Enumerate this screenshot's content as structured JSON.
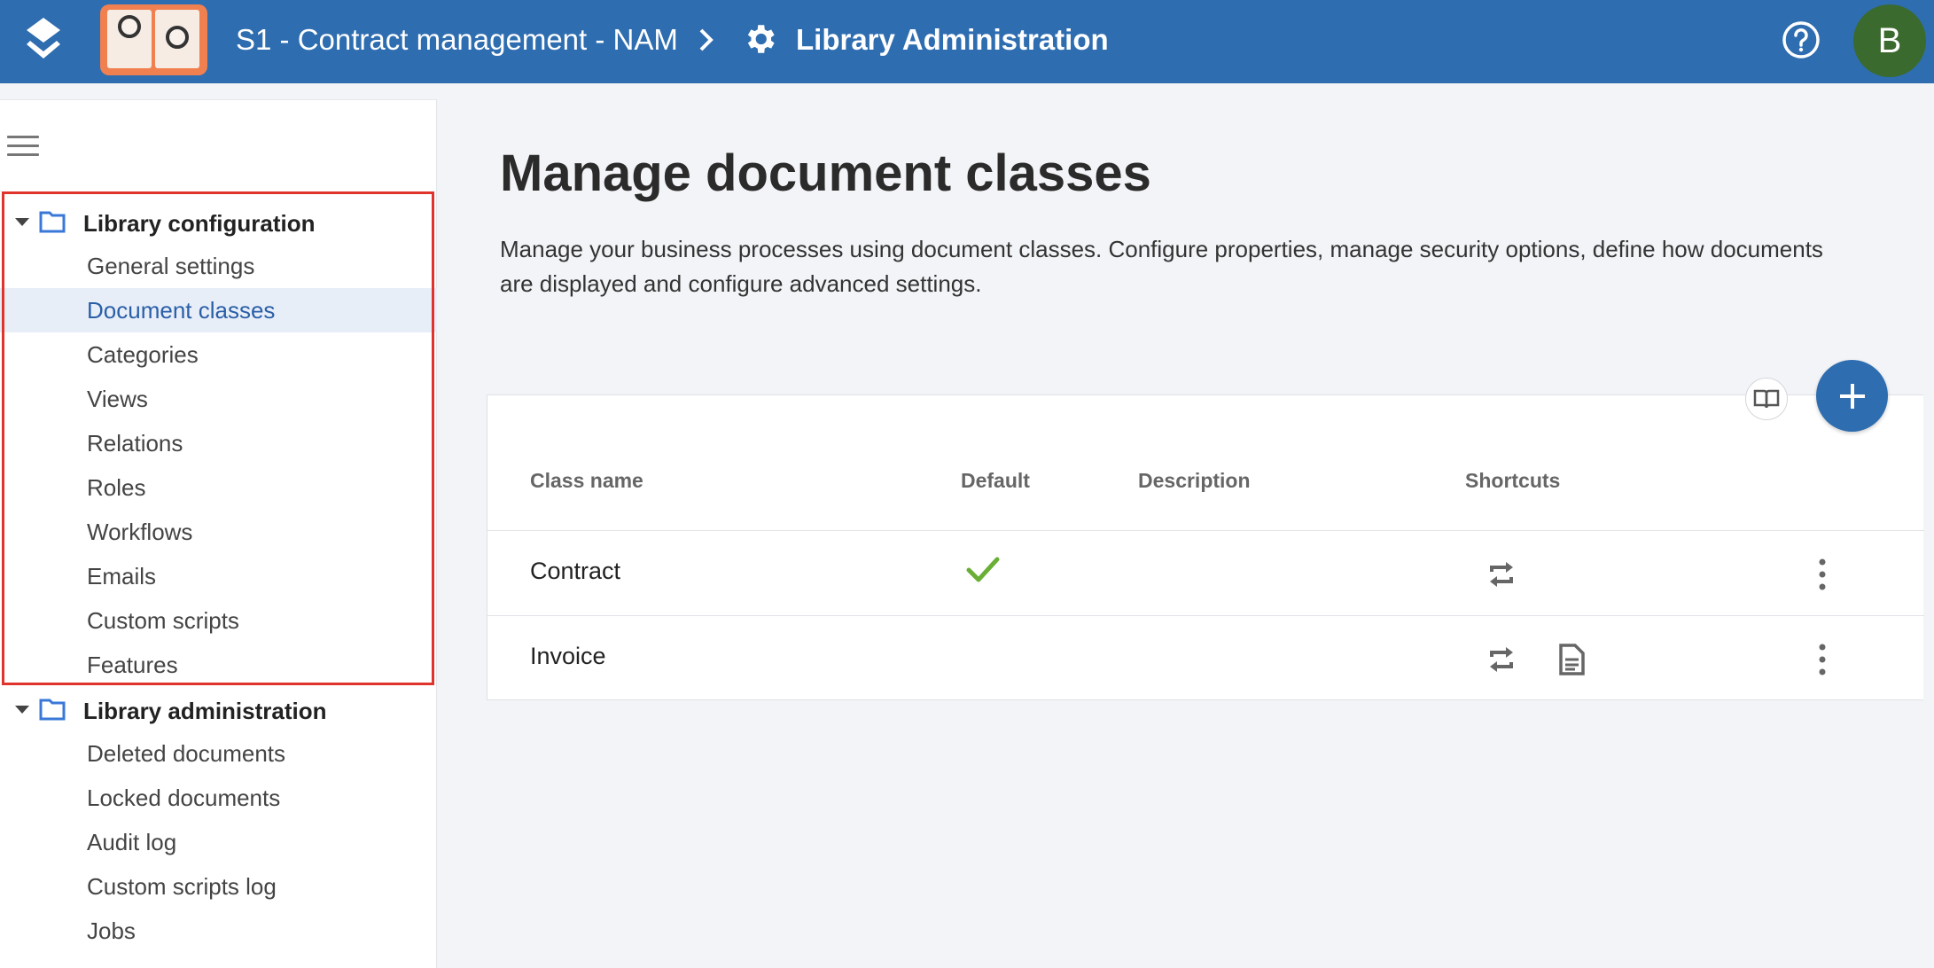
{
  "header": {
    "library_name": "S1 - Contract management - NAM",
    "breadcrumb_separator": ">",
    "current_page": "Library Administration",
    "avatar_initial": "B",
    "brand_color": "#2e6db0"
  },
  "sidebar": {
    "groups": [
      {
        "label": "Library configuration",
        "items": [
          {
            "label": "General settings"
          },
          {
            "label": "Document classes",
            "active": true
          },
          {
            "label": "Categories"
          },
          {
            "label": "Views"
          },
          {
            "label": "Relations"
          },
          {
            "label": "Roles"
          },
          {
            "label": "Workflows"
          },
          {
            "label": "Emails"
          },
          {
            "label": "Custom scripts"
          },
          {
            "label": "Features"
          }
        ]
      },
      {
        "label": "Library administration",
        "items": [
          {
            "label": "Deleted documents"
          },
          {
            "label": "Locked documents"
          },
          {
            "label": "Audit log"
          },
          {
            "label": "Custom scripts log"
          },
          {
            "label": "Jobs"
          }
        ]
      }
    ],
    "highlight_color": "#e0332b"
  },
  "main": {
    "title": "Manage document classes",
    "description": "Manage your business processes using document classes. Configure properties, manage security options, define how documents are displayed and configure advanced settings.",
    "table": {
      "columns": [
        "Class name",
        "Default",
        "Description",
        "Shortcuts"
      ],
      "rows": [
        {
          "class_name": "Contract",
          "default": true,
          "description": "",
          "shortcuts": [
            "sync-icon"
          ]
        },
        {
          "class_name": "Invoice",
          "default": false,
          "description": "",
          "shortcuts": [
            "sync-icon",
            "document-icon"
          ]
        }
      ]
    },
    "icons": {
      "book": "book-icon",
      "add": "plus-icon",
      "more": "more-vert-icon"
    }
  }
}
